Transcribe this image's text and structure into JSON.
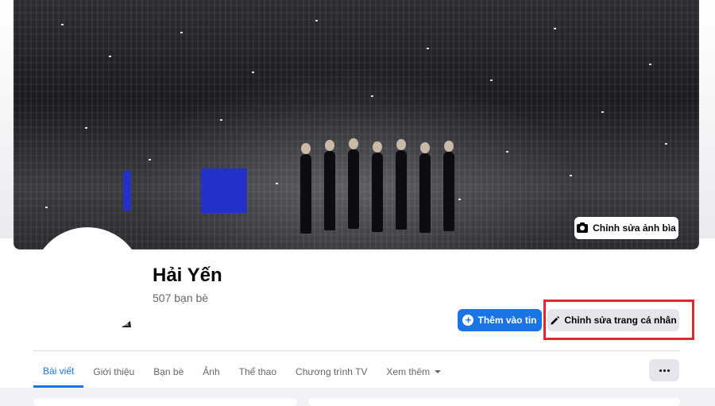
{
  "cover": {
    "edit_cover_label": "Chỉnh sửa ảnh bìa"
  },
  "profile": {
    "name": "Hải Yến",
    "friends": "507 bạn bè"
  },
  "actions": {
    "add_story_label": "Thêm vào tin",
    "edit_profile_label": "Chỉnh sửa trang cá nhân"
  },
  "tabs": [
    {
      "label": "Bài viết",
      "active": true
    },
    {
      "label": "Giới thiệu"
    },
    {
      "label": "Bạn bè"
    },
    {
      "label": "Ảnh"
    },
    {
      "label": "Thể thao"
    },
    {
      "label": "Chương trình TV"
    },
    {
      "label": "Xem thêm"
    }
  ],
  "colors": {
    "accent": "#1b74e4",
    "highlight": "#e0282e"
  },
  "icons": {
    "cover_button": "camera-icon",
    "story_button": "plus-circle-icon",
    "edit_button": "pencil-icon",
    "more_tab": "caret-down-icon",
    "overflow": "more-dots-icon"
  }
}
